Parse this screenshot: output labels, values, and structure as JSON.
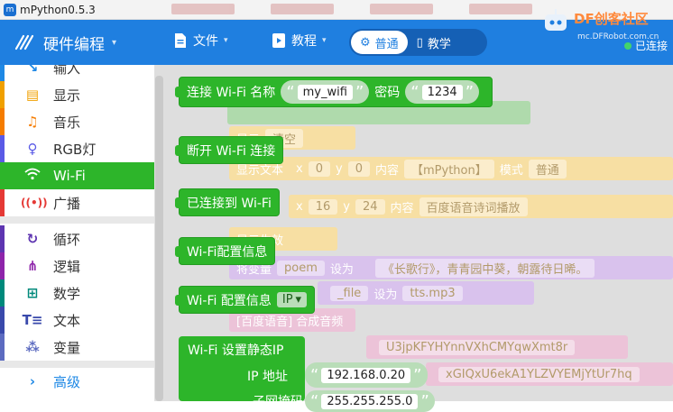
{
  "window": {
    "title": "mPython0.5.3"
  },
  "toolbar": {
    "mode_label": "硬件编程",
    "file_label": "文件",
    "tutorial_label": "教程",
    "mode_normal": "普通",
    "mode_teach": "教学"
  },
  "brand": {
    "name": "DF创客社区",
    "url": "mc.DFRobot.com.cn",
    "status": "已连接"
  },
  "sidebar": {
    "items": [
      {
        "label": "输入",
        "icon": "input-icon",
        "color": "#1e88e5"
      },
      {
        "label": "显示",
        "icon": "display-icon",
        "color": "#f0a000"
      },
      {
        "label": "音乐",
        "icon": "music-icon",
        "color": "#f57c00"
      },
      {
        "label": "RGB灯",
        "icon": "bulb-icon",
        "color": "#5a5ae6"
      },
      {
        "label": "Wi-Fi",
        "icon": "wifi-icon",
        "color": "#2db52a"
      },
      {
        "label": "广播",
        "icon": "broadcast-icon",
        "color": "#e53935"
      },
      {
        "label": "循环",
        "icon": "loop-icon",
        "color": "#5e35b1"
      },
      {
        "label": "逻辑",
        "icon": "logic-icon",
        "color": "#8e24aa"
      },
      {
        "label": "数学",
        "icon": "math-icon",
        "color": "#00897b"
      },
      {
        "label": "文本",
        "icon": "text-icon",
        "color": "#3949ab"
      },
      {
        "label": "变量",
        "icon": "variable-icon",
        "color": "#5c6bc0"
      },
      {
        "label": "高级",
        "icon": "chevron-right-icon",
        "color": "#1e88e5"
      }
    ]
  },
  "blocks": {
    "connect_label": "连接 Wi-Fi 名称",
    "ssid_value": "my_wifi",
    "password_label": "密码",
    "password_value": "1234",
    "disconnect_label": "断开 Wi-Fi 连接",
    "connected_label": "已连接到 Wi-Fi",
    "config_label": "Wi-Fi配置信息",
    "config_field_label": "Wi-Fi 配置信息",
    "config_field_value": "IP",
    "static_ip_label": "Wi-Fi 设置静态IP",
    "ip_label": "IP 地址",
    "ip_value": "192.168.0.20",
    "mask_label": "子网掩码",
    "mask_value": "255.255.255.0"
  },
  "background_blocks": {
    "oled_clear_label": "显示",
    "oled_clear_value": "清空",
    "show_text_label": "显示文本",
    "x_label": "x",
    "y_label": "y",
    "x1": "0",
    "y1": "0",
    "content_label": "内容",
    "text1": "【mPython】",
    "mode_label": "模式",
    "mode_value": "普通",
    "x2": "16",
    "y2": "24",
    "text2": "百度语音诗词播放",
    "display_effect": "显示生效",
    "set_var_label": "将变量",
    "var_poem": "poem",
    "set_to_label": "设为",
    "poem_text": "《长歌行》，青青园中葵，朝露待日晞。",
    "var_file": "_file",
    "file_value": "tts.mp3",
    "baidu_tts": "[百度语音] 合成音频",
    "api_key": "U3jpKFYHYnnVXhCMYqwXmt8r",
    "secret_key": "xGIQxU6ekA1YLZVYEMjYtUr7hq"
  }
}
